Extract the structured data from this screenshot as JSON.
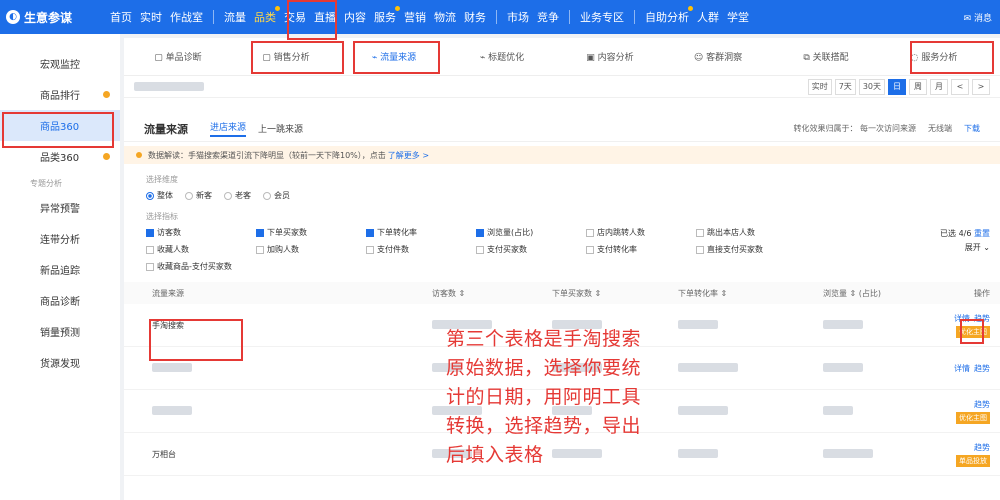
{
  "topbar": {
    "app_title": "生意参谋",
    "nav": [
      "首页",
      "实时",
      "作战室",
      "流量",
      "品类",
      "交易",
      "直播",
      "内容",
      "服务",
      "营销",
      "物流",
      "财务",
      "市场",
      "竞争",
      "业务专区",
      "自助分析",
      "人群",
      "学堂"
    ],
    "message_label": "消息"
  },
  "sidebar": {
    "group_header": "专题分析",
    "items": [
      "宏观监控",
      "商品排行",
      "商品360",
      "品类360"
    ],
    "items2": [
      "异常预警",
      "连带分析",
      "新品追踪",
      "商品诊断",
      "销量预测",
      "货源发现"
    ]
  },
  "subtabs": [
    "单品诊断",
    "销售分析",
    "流量来源",
    "标题优化",
    "内容分析",
    "客群洞察",
    "关联搭配",
    "服务分析"
  ],
  "datebar": {
    "buttons": [
      "实时",
      "7天",
      "30天",
      "日",
      "周",
      "月",
      "<",
      ">"
    ]
  },
  "section": {
    "title": "流量来源",
    "tab_in": "进店来源",
    "tab_prev": "上一跳来源",
    "right1": "转化效果归属于：  每一次访问来源",
    "right2": "无线端",
    "right3": "下载",
    "notice_text": "数据解读：手猫搜索渠道引流下降明显（较前一天下降10%），点击",
    "notice_link": "了解更多 >",
    "dim_label": "选择维度",
    "dims": [
      "整体",
      "新客",
      "老客",
      "会员"
    ],
    "metric_label": "选择指标",
    "metrics": [
      {
        "t": "访客数",
        "on": true
      },
      {
        "t": "下单买家数",
        "on": true
      },
      {
        "t": "下单转化率",
        "on": true
      },
      {
        "t": "浏览量(占比)",
        "on": true
      },
      {
        "t": "店内跳转人数",
        "on": false
      },
      {
        "t": "跳出本店人数",
        "on": false
      },
      {
        "t": "收藏人数",
        "on": false
      },
      {
        "t": "加购人数",
        "on": false
      },
      {
        "t": "支付件数",
        "on": false
      },
      {
        "t": "支付买家数",
        "on": false
      },
      {
        "t": "支付转化率",
        "on": false
      },
      {
        "t": "直接支付买家数",
        "on": false
      },
      {
        "t": "收藏商品-支付买家数",
        "on": false
      }
    ],
    "selected_count": "已选 4/6",
    "reset": "重置",
    "expand": "展开",
    "columns": [
      "流量来源",
      "访客数",
      "下单买家数",
      "下单转化率",
      "浏览量",
      "(占比)",
      "操作"
    ],
    "rows": [
      {
        "name": "手淘搜索",
        "ops": [
          "详情",
          "趋势"
        ],
        "tag": "优化主图"
      },
      {
        "name": "",
        "ops": [
          "详情",
          "趋势"
        ],
        "tag": ""
      },
      {
        "name": "",
        "ops": [
          "趋势"
        ],
        "tag": "优化主图"
      },
      {
        "name": "万相台",
        "ops": [
          "趋势"
        ],
        "tag": "单品投放"
      }
    ]
  },
  "annotation": [
    "第三个表格是手淘搜索",
    "原始数据，选择你要统",
    "计的日期，用阿明工具",
    "转换，选择趋势，导出",
    "后填入表格"
  ],
  "colors": {
    "brand_blue": "#1d6ee8",
    "annotation_red": "#e53935",
    "badge_orange": "#f5a623"
  }
}
